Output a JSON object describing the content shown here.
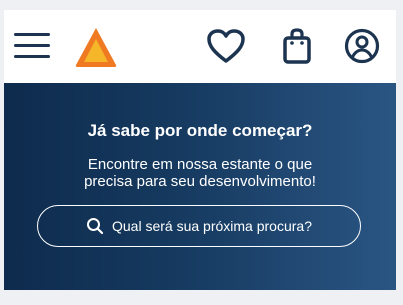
{
  "header": {
    "menu_icon": "hamburger-menu-icon",
    "logo_icon": "triangle-logo-icon",
    "wishlist_icon": "heart-icon",
    "cart_icon": "shopping-bag-icon",
    "account_icon": "user-circle-icon"
  },
  "hero": {
    "title": "Já sabe por onde começar?",
    "subtitle_line1": "Encontre em nossa estante o que",
    "subtitle_line2": "precisa para seu desenvolvimento!",
    "search_label": "Qual será sua próxima procura?",
    "search_icon": "search-icon"
  },
  "colors": {
    "navy": "#1c3450",
    "hero_start": "#0e2b4d",
    "hero_end": "#2a5583",
    "logo_orange": "#f07a22",
    "logo_yellow": "#f6b62a"
  }
}
